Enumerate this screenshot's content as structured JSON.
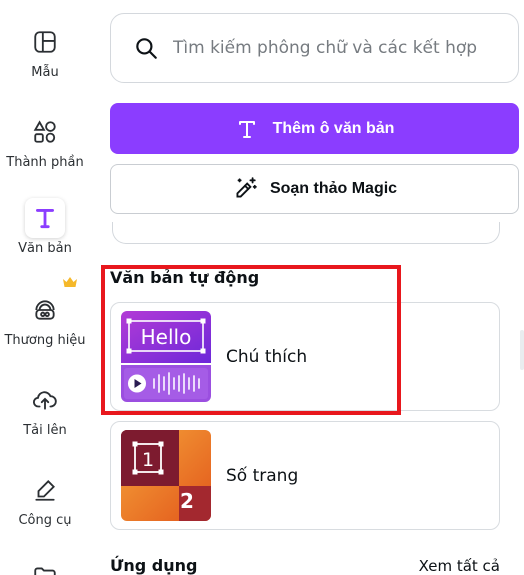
{
  "sidebar": {
    "items": [
      {
        "label": "Mẫu",
        "icon": "template-icon"
      },
      {
        "label": "Thành phần",
        "icon": "elements-icon"
      },
      {
        "label": "Văn bản",
        "icon": "text-icon"
      },
      {
        "label": "Thương hiệu",
        "icon": "brand-icon"
      },
      {
        "label": "Tải lên",
        "icon": "upload-icon"
      },
      {
        "label": "Công cụ",
        "icon": "tools-icon"
      }
    ],
    "active_index": 2
  },
  "search": {
    "placeholder": "Tìm kiếm phông chữ và các kết hợp"
  },
  "actions": {
    "add_text_label": "Thêm ô văn bản",
    "magic_write_label": "Soạn thảo Magic"
  },
  "auto_text": {
    "title": "Văn bản tự động",
    "cards": [
      {
        "label": "Chú thích",
        "thumb_text": "Hello"
      },
      {
        "label": "Số trang",
        "thumb_num_1": "1",
        "thumb_num_2": "2"
      }
    ]
  },
  "apps": {
    "title": "Ứng dụng",
    "see_all": "Xem tất cả"
  },
  "colors": {
    "accent": "#8b3dff",
    "highlight": "#e8171d",
    "card_red": "#8a1c2e",
    "card_orange": "#f07a1e"
  }
}
